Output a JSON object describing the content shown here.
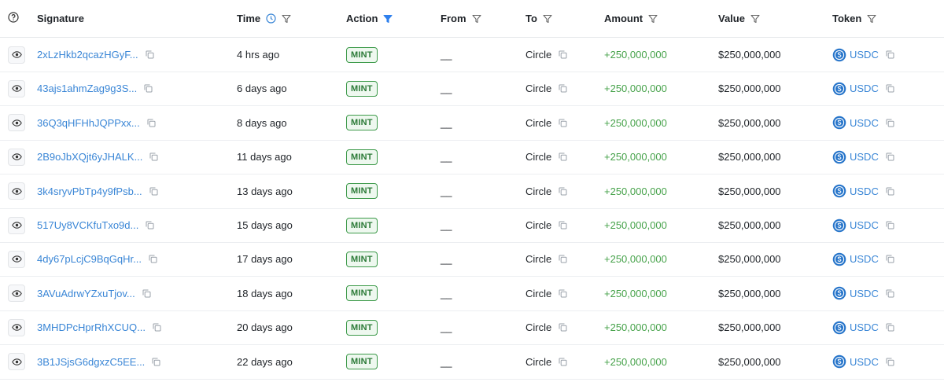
{
  "header": {
    "help_icon": "help-circle-icon",
    "signature": "Signature",
    "time": "Time",
    "action": "Action",
    "from": "From",
    "to": "To",
    "amount": "Amount",
    "value": "Value",
    "token": "Token"
  },
  "colors": {
    "link": "#3a86d6",
    "amount_positive": "#46a24a",
    "badge_border": "#3d9a4a",
    "filter_active": "#2f80ed",
    "usdc_blue": "#2775ca"
  },
  "rows": [
    {
      "signature": "2xLzHkb2qcazHGyF...",
      "time": "4 hrs ago",
      "action": "MINT",
      "from": "__",
      "to": "Circle",
      "amount": "+250,000,000",
      "value": "$250,000,000",
      "token": "USDC"
    },
    {
      "signature": "43ajs1ahmZag9g3S...",
      "time": "6 days ago",
      "action": "MINT",
      "from": "__",
      "to": "Circle",
      "amount": "+250,000,000",
      "value": "$250,000,000",
      "token": "USDC"
    },
    {
      "signature": "36Q3qHFHhJQPPxx...",
      "time": "8 days ago",
      "action": "MINT",
      "from": "__",
      "to": "Circle",
      "amount": "+250,000,000",
      "value": "$250,000,000",
      "token": "USDC"
    },
    {
      "signature": "2B9oJbXQjt6yJHALK...",
      "time": "11 days ago",
      "action": "MINT",
      "from": "__",
      "to": "Circle",
      "amount": "+250,000,000",
      "value": "$250,000,000",
      "token": "USDC"
    },
    {
      "signature": "3k4sryvPbTp4y9fPsb...",
      "time": "13 days ago",
      "action": "MINT",
      "from": "__",
      "to": "Circle",
      "amount": "+250,000,000",
      "value": "$250,000,000",
      "token": "USDC"
    },
    {
      "signature": "517Uy8VCKfuTxo9d...",
      "time": "15 days ago",
      "action": "MINT",
      "from": "__",
      "to": "Circle",
      "amount": "+250,000,000",
      "value": "$250,000,000",
      "token": "USDC"
    },
    {
      "signature": "4dy67pLcjC9BqGqHr...",
      "time": "17 days ago",
      "action": "MINT",
      "from": "__",
      "to": "Circle",
      "amount": "+250,000,000",
      "value": "$250,000,000",
      "token": "USDC"
    },
    {
      "signature": "3AVuAdrwYZxuTjov...",
      "time": "18 days ago",
      "action": "MINT",
      "from": "__",
      "to": "Circle",
      "amount": "+250,000,000",
      "value": "$250,000,000",
      "token": "USDC"
    },
    {
      "signature": "3MHDPcHprRhXCUQ...",
      "time": "20 days ago",
      "action": "MINT",
      "from": "__",
      "to": "Circle",
      "amount": "+250,000,000",
      "value": "$250,000,000",
      "token": "USDC"
    },
    {
      "signature": "3B1JSjsG6dgxzC5EE...",
      "time": "22 days ago",
      "action": "MINT",
      "from": "__",
      "to": "Circle",
      "amount": "+250,000,000",
      "value": "$250,000,000",
      "token": "USDC"
    }
  ]
}
